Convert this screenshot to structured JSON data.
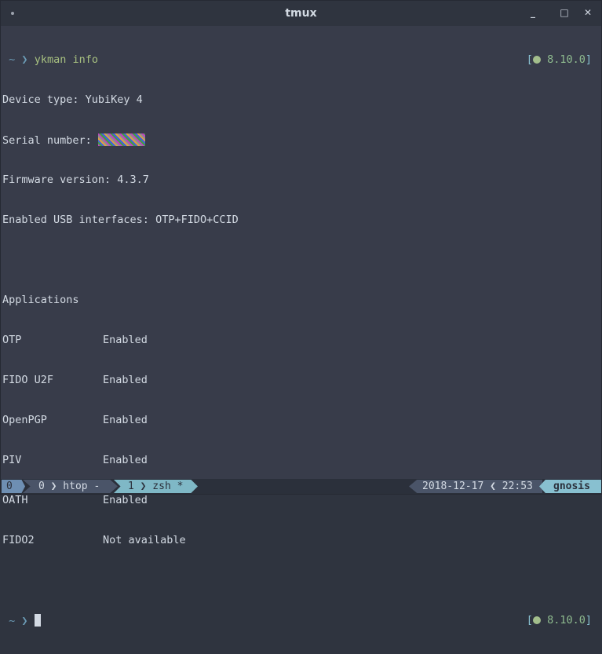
{
  "window": {
    "title": "tmux",
    "minimize": "_",
    "maximize": "□",
    "close": "✕"
  },
  "prompt": {
    "tilde": "~",
    "arrow": "❯",
    "command": "ykman info",
    "rprompt_open": "[",
    "rprompt_version": "8.10.0",
    "rprompt_close": "]"
  },
  "output": {
    "device_type": "Device type: YubiKey 4",
    "serial_label": "Serial number: ",
    "firmware": "Firmware version: 4.3.7",
    "usb": "Enabled USB interfaces: OTP+FIDO+CCID",
    "applications_header": "Applications",
    "applications": [
      {
        "name": "OTP",
        "status": "Enabled"
      },
      {
        "name": "FIDO U2F",
        "status": "Enabled"
      },
      {
        "name": "OpenPGP",
        "status": "Enabled"
      },
      {
        "name": "PIV",
        "status": "Enabled"
      },
      {
        "name": "OATH",
        "status": "Enabled"
      },
      {
        "name": "FIDO2",
        "status": "Not available"
      }
    ]
  },
  "statusbar": {
    "session": "0",
    "windows": [
      {
        "label": "0 ❯ htop -"
      },
      {
        "label": "1 ❯ zsh *"
      }
    ],
    "datetime": "2018-12-17 ❮ 22:53",
    "host": "gnosis"
  }
}
